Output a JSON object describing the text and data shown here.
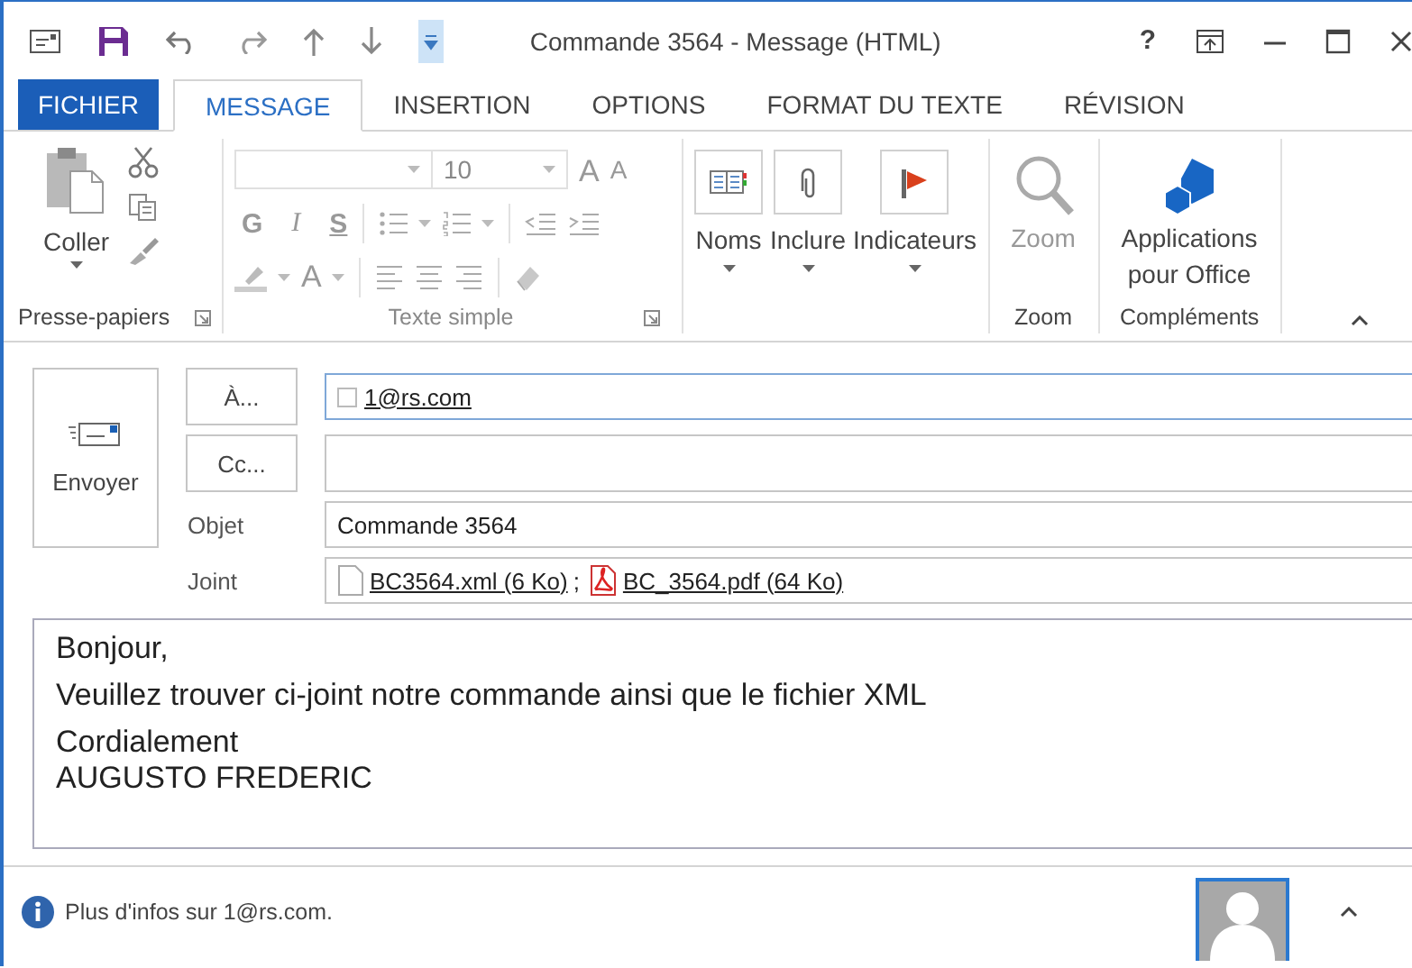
{
  "window": {
    "title": "Commande 3564 - Message (HTML)",
    "help": "?"
  },
  "tabs": [
    {
      "label": "FICHIER",
      "kind": "file",
      "selected": false
    },
    {
      "label": "MESSAGE",
      "kind": "tab",
      "selected": true
    },
    {
      "label": "INSERTION",
      "kind": "tab",
      "selected": false
    },
    {
      "label": "OPTIONS",
      "kind": "tab",
      "selected": false
    },
    {
      "label": "FORMAT DU TEXTE",
      "kind": "tab",
      "selected": false
    },
    {
      "label": "RÉVISION",
      "kind": "tab",
      "selected": false
    }
  ],
  "ribbon": {
    "clipboard": {
      "label": "Presse-papiers",
      "paste": "Coller"
    },
    "basic_text": {
      "label": "Texte simple",
      "disabled": true,
      "font_size": "10",
      "grow": "A",
      "shrink": "A",
      "bold": "G",
      "italic": "I",
      "underline": "S",
      "font_color": "A"
    },
    "include": [
      {
        "label": "Noms",
        "kind": "book"
      },
      {
        "label": "Inclure",
        "kind": "clip"
      },
      {
        "label": "Indicateurs",
        "kind": "flag"
      }
    ],
    "zoom": {
      "button": "Zoom",
      "label": "Zoom",
      "disabled": true
    },
    "addins": {
      "button": "Applications pour Office",
      "label": "Compléments"
    }
  },
  "compose": {
    "send": "Envoyer",
    "to_button": "À...",
    "to": "1@rs.com",
    "cc_button": "Cc...",
    "subject_label": "Objet",
    "subject": "Commande 3564",
    "attach_label": "Joint",
    "attachments": [
      {
        "name": "BC3564.xml (6 Ko)",
        "kind": "xml",
        "separator": ";"
      },
      {
        "name": "BC_3564.pdf (64 Ko)",
        "kind": "pdf"
      }
    ]
  },
  "body": {
    "paragraphs": [
      [
        "Bonjour,"
      ],
      [
        "Veuillez trouver ci-joint notre commande ainsi que le fichier XML"
      ],
      [
        "Cordialement",
        "AUGUSTO FREDERIC"
      ]
    ]
  },
  "status_bar": {
    "text": "Plus d'infos sur 1@rs.com."
  }
}
